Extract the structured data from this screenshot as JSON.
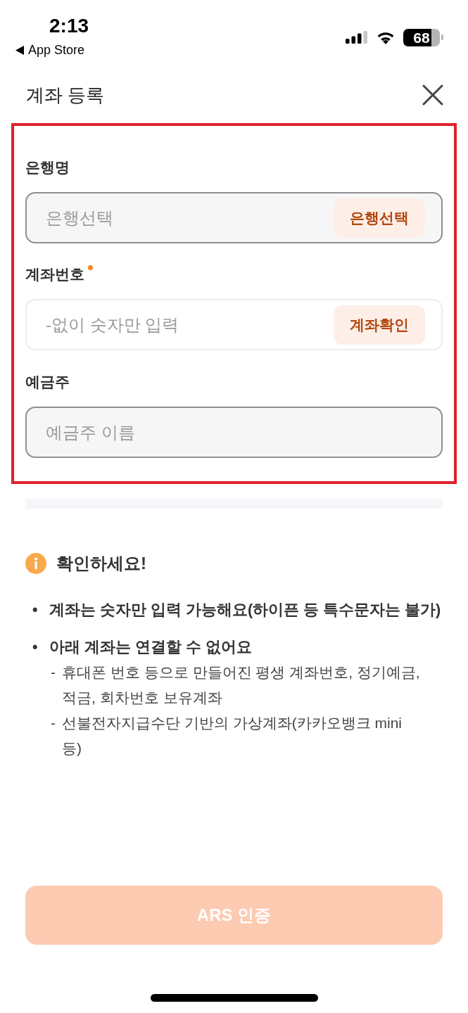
{
  "status_bar": {
    "time": "2:13",
    "back_label": "App Store",
    "battery": "68"
  },
  "header": {
    "title": "계좌 등록"
  },
  "form": {
    "highlighted": true,
    "fields": [
      {
        "label": "은행명",
        "required": false,
        "readonly": true,
        "placeholder": "은행선택",
        "button": "은행선택"
      },
      {
        "label": "계좌번호",
        "required": true,
        "readonly": false,
        "placeholder": "-없이 숫자만 입력",
        "button": "계좌확인"
      },
      {
        "label": "예금주",
        "required": false,
        "readonly": true,
        "placeholder": "예금주 이름"
      }
    ]
  },
  "notice": {
    "title": "확인하세요!",
    "items": [
      {
        "marker": "•",
        "text": "계좌는 숫자만 입력 가능해요(하이픈 등 특수문자는 불가)"
      },
      {
        "marker": "•",
        "text": "아래 계좌는 연결할 수 없어요",
        "children": [
          {
            "marker": "-",
            "text": "휴대폰 번호 등으로 만들어진 평생 계좌번호, 정기예금, 적금, 회차번호 보유계좌"
          },
          {
            "marker": "-",
            "text": "선불전자지급수단 기반의 가상계좌(카카오뱅크 mini 등)"
          }
        ]
      }
    ]
  },
  "submit": {
    "label": "ARS 인증",
    "disabled": true
  }
}
